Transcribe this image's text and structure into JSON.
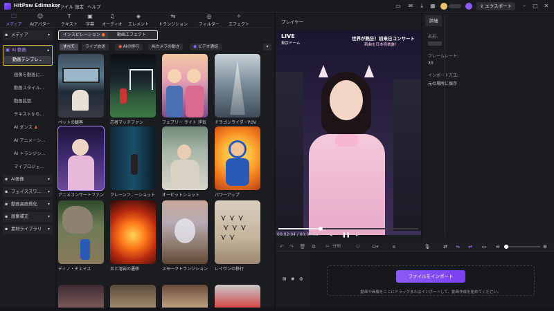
{
  "app": {
    "name": "HitPaw Edimakor"
  },
  "menu": [
    "ファイル",
    "設定",
    "ヘルプ"
  ],
  "titlebar_right": {
    "export_label": "エクスポート"
  },
  "toolbar": [
    {
      "label": "メディア",
      "icon": "folder-icon",
      "active": true
    },
    {
      "label": "AIアバター",
      "icon": "avatar-icon"
    },
    {
      "label": "テキスト",
      "icon": "text-icon"
    },
    {
      "label": "字幕",
      "icon": "subtitle-icon"
    },
    {
      "label": "オーディオ",
      "icon": "audio-icon"
    },
    {
      "label": "エレメント",
      "icon": "element-icon"
    },
    {
      "label": "トランジション",
      "icon": "transition-icon"
    },
    {
      "label": "フィルター",
      "icon": "filter-icon"
    },
    {
      "label": "エフェクト",
      "icon": "effect-icon"
    }
  ],
  "sidebar": {
    "items": [
      {
        "label": "メディア",
        "caret": "▾",
        "type": "group"
      },
      {
        "label": "AI 動画",
        "caret": "▴",
        "type": "group-open"
      },
      {
        "label": "動画テンプレ...",
        "type": "sub",
        "selected": true
      },
      {
        "label": "画像を動画に...",
        "type": "sub"
      },
      {
        "label": "動画スタイル...",
        "type": "sub"
      },
      {
        "label": "動画拡張",
        "type": "sub"
      },
      {
        "label": "テキストから...",
        "type": "sub"
      },
      {
        "label": "AI ダンス",
        "type": "sub"
      },
      {
        "label": "AI アニメーシ...",
        "type": "sub"
      },
      {
        "label": "AI トランジシ...",
        "type": "sub"
      },
      {
        "label": "マイプロジェ...",
        "type": "sub"
      },
      {
        "label": "AI画像",
        "caret": "▾",
        "type": "group"
      },
      {
        "label": "フェイススワ...",
        "caret": "▾",
        "type": "group"
      },
      {
        "label": "動画高画質化",
        "caret": "▾",
        "type": "group"
      },
      {
        "label": "画像補正",
        "caret": "▾",
        "type": "group"
      },
      {
        "label": "素材ライブラリ",
        "caret": "▾",
        "type": "group"
      }
    ]
  },
  "content": {
    "tabs": [
      "インスピレーション",
      "動画エフェクト"
    ],
    "chips": [
      "すべて",
      "ライブ放送",
      "AIの移行",
      "AIカメラの動き",
      "ビデオ通話"
    ],
    "cards": [
      {
        "caption": "ペットの観客"
      },
      {
        "caption": "芯者マッチファン"
      },
      {
        "caption": "フェアリー ライト 浮気"
      },
      {
        "caption": "ドラゴンライダーPOV"
      },
      {
        "caption": "アニメコンサートファン"
      },
      {
        "caption": "クレーンフ...ーショット"
      },
      {
        "caption": "オービットショット"
      },
      {
        "caption": "パワーアップ"
      },
      {
        "caption": "ディノ・チェイス"
      },
      {
        "caption": "炎と溶岩の遷移"
      },
      {
        "caption": "スモークトランジション"
      },
      {
        "caption": "レイヴンの移行"
      }
    ]
  },
  "player": {
    "title": "プレイヤー",
    "overlay_live": "LIVE",
    "overlay_venue": "東京ドーム",
    "overlay_headline": "世界が熱狂！初来日コンサート",
    "overlay_sub": "新曲を日本初披露！",
    "time_current": "00:02:04",
    "time_total": "00:07:01",
    "progress": 0.3
  },
  "details": {
    "tab": "詳細",
    "name_label": "名前:",
    "framerate_label": "フレームレート:",
    "framerate_value": "30",
    "import_label": "インポート方法:",
    "import_value": "元の場所に保存"
  },
  "timeline": {
    "split_label": "分割",
    "import_button": "ファイルをインポート",
    "drop_hint": "動画や画像をここにドラッグまたはインポートして、動画作成を始めてください。"
  },
  "colors": {
    "accent": "#8b5cf6",
    "highlight": "#e6c34a"
  }
}
